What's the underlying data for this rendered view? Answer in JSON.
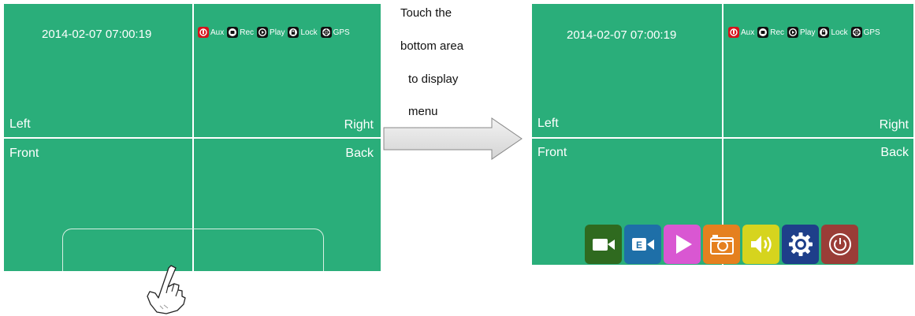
{
  "left_screen": {
    "datetime": "2014-02-07 07:00:19",
    "status": [
      {
        "label": "Aux",
        "icon": "aux-icon"
      },
      {
        "label": "Rec",
        "icon": "rec-icon"
      },
      {
        "label": "Play",
        "icon": "play-icon"
      },
      {
        "label": "Lock",
        "icon": "lock-icon"
      },
      {
        "label": "GPS",
        "icon": "gps-icon"
      }
    ],
    "quadrants": {
      "top_left": "Left",
      "top_right": "Right",
      "bottom_left": "Front",
      "bottom_right": "Back"
    }
  },
  "instruction": {
    "lines": [
      "Touch the",
      "bottom area",
      "to display",
      "menu"
    ]
  },
  "right_screen": {
    "datetime": "2014-02-07 07:00:19",
    "status": [
      {
        "label": "Aux",
        "icon": "aux-icon"
      },
      {
        "label": "Rec",
        "icon": "rec-icon"
      },
      {
        "label": "Play",
        "icon": "play-icon"
      },
      {
        "label": "Lock",
        "icon": "lock-icon"
      },
      {
        "label": "GPS",
        "icon": "gps-icon"
      }
    ],
    "quadrants": {
      "top_left": "Left",
      "top_right": "Right",
      "bottom_left": "Front",
      "bottom_right": "Back"
    },
    "menu": [
      {
        "icon": "video-camera-icon",
        "color": "#2f6a1f"
      },
      {
        "icon": "event-record-icon",
        "color": "#1e6fa8"
      },
      {
        "icon": "play-icon",
        "color": "#d957d2"
      },
      {
        "icon": "camera-icon",
        "color": "#e5801f"
      },
      {
        "icon": "speaker-icon",
        "color": "#d6d41e"
      },
      {
        "icon": "gear-icon",
        "color": "#1e3f8a"
      },
      {
        "icon": "power-icon",
        "color": "#9a3d37"
      }
    ]
  },
  "colors": {
    "screen_bg": "#2aae7a",
    "divider": "#ffffff",
    "aux_red": "#d6121b"
  }
}
